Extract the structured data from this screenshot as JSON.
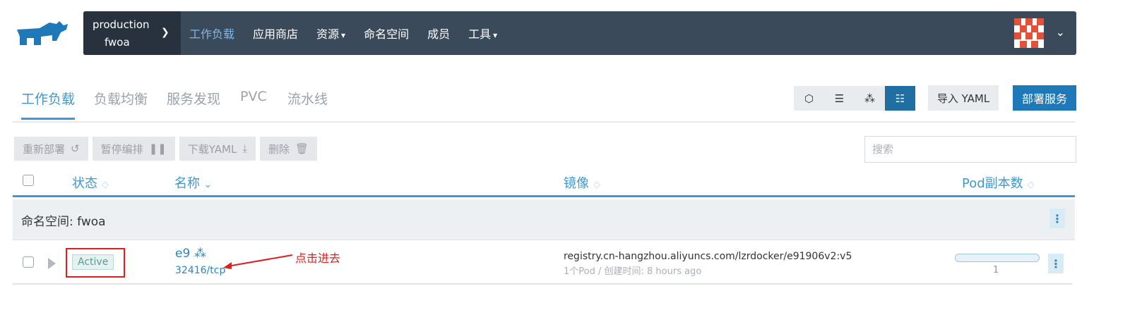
{
  "header": {
    "cluster": "production",
    "project": "fwoa",
    "nav": [
      {
        "label": "工作负载",
        "active": true,
        "dropdown": false
      },
      {
        "label": "应用商店",
        "active": false,
        "dropdown": false
      },
      {
        "label": "资源",
        "active": false,
        "dropdown": true
      },
      {
        "label": "命名空间",
        "active": false,
        "dropdown": false
      },
      {
        "label": "成员",
        "active": false,
        "dropdown": false
      },
      {
        "label": "工具",
        "active": false,
        "dropdown": true
      }
    ]
  },
  "subtabs": [
    "工作负载",
    "负载均衡",
    "服务发现",
    "PVC",
    "流水线"
  ],
  "view_buttons": [
    "cube-icon",
    "list-icon",
    "nodes-icon",
    "tree-list-icon"
  ],
  "buttons": {
    "import_yaml": "导入 YAML",
    "deploy": "部署服务"
  },
  "actions": [
    {
      "label": "重新部署",
      "icon": "redeploy-icon",
      "glyph": "↺"
    },
    {
      "label": "暂停编排",
      "icon": "pause-icon",
      "glyph": "❚❚"
    },
    {
      "label": "下载YAML",
      "icon": "download-icon",
      "glyph": "⤓"
    },
    {
      "label": "删除",
      "icon": "trash-icon",
      "glyph": "🗑"
    }
  ],
  "search": {
    "placeholder": "搜索",
    "value": ""
  },
  "columns": {
    "state": "状态",
    "name": "名称",
    "image": "镜像",
    "pods": "Pod副本数"
  },
  "group": {
    "label": "命名空间: fwoa"
  },
  "row": {
    "state": "Active",
    "name": "e9",
    "port": "32416/tcp",
    "annotation": "点击进去",
    "image": "registry.cn-hangzhou.aliyuncs.com/lzrdocker/e91906v2:v5",
    "meta": "1个Pod / 创建时间: 8 hours ago",
    "pod_count": "1",
    "pod_fraction": 1.0
  },
  "colors": {
    "nav_bg": "#3b4a5b",
    "accent": "#3d98d3",
    "primary_button": "#1f78b8",
    "annotation": "#e21d1d"
  }
}
